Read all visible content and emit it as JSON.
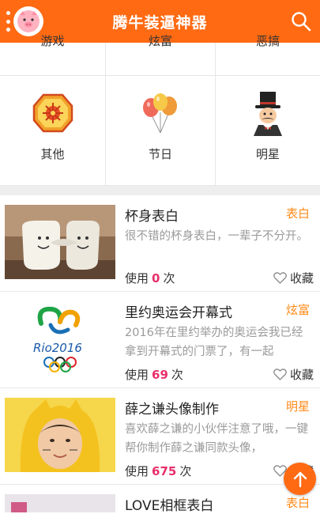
{
  "app": {
    "title": "腾牛装逼神器"
  },
  "categories_top_partial": [
    "游戏",
    "炫富",
    "恶搞"
  ],
  "categories": [
    {
      "label": "其他",
      "icon": "hexagon-flower-icon"
    },
    {
      "label": "节日",
      "icon": "balloons-icon"
    },
    {
      "label": "明星",
      "icon": "magician-icon"
    }
  ],
  "items": [
    {
      "title": "杯身表白",
      "tag": "表白",
      "desc": "很不错的杯身表白，一辈子不分开。",
      "use_prefix": "使用",
      "count": "0",
      "use_suffix": "次",
      "fav": "收藏"
    },
    {
      "title": "里约奥运会开幕式",
      "tag": "炫富",
      "desc": "2016年在里约举办的奥运会我已经拿到开幕式的门票了，有一起",
      "use_prefix": "使用",
      "count": "69",
      "use_suffix": "次",
      "fav": "收藏"
    },
    {
      "title": "薛之谦头像制作",
      "tag": "明星",
      "desc": "喜欢薛之谦的小伙伴注意了哦，一键帮你制作薛之谦同款头像，",
      "use_prefix": "使用",
      "count": "675",
      "use_suffix": "次",
      "fav": "收藏"
    },
    {
      "title": "LOVE相框表白",
      "tag": "表白"
    }
  ],
  "colors": {
    "accent": "#ff6a13",
    "tag": "#ff8a18",
    "count": "#e8306c"
  }
}
